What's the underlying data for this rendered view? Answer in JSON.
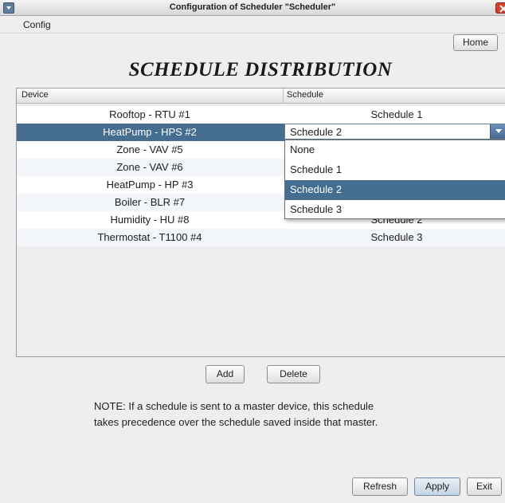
{
  "window": {
    "title": "Configuration of Scheduler \"Scheduler\""
  },
  "menubar": {
    "config_label": "Config",
    "home_label": "Home"
  },
  "heading": "SCHEDULE DISTRIBUTION",
  "table": {
    "columns": [
      "Device",
      "Schedule"
    ],
    "rows": [
      {
        "device": "Rooftop - RTU #1",
        "schedule": "Schedule 1"
      },
      {
        "device": "HeatPump - HPS #2",
        "schedule": "Schedule 2"
      },
      {
        "device": "Zone - VAV #5",
        "schedule": ""
      },
      {
        "device": "Zone - VAV #6",
        "schedule": ""
      },
      {
        "device": "HeatPump - HP #3",
        "schedule": ""
      },
      {
        "device": "Boiler - BLR #7",
        "schedule": ""
      },
      {
        "device": "Humidity - HU #8",
        "schedule": "Schedule 2"
      },
      {
        "device": "Thermostat - T1100 #4",
        "schedule": "Schedule 3"
      }
    ],
    "selected_row": 1
  },
  "schedule_combo": {
    "value": "Schedule 2",
    "options": [
      "None",
      "Schedule 1",
      "Schedule 2",
      "Schedule 3"
    ],
    "highlighted_index": 2
  },
  "actions": {
    "add_label": "Add",
    "delete_label": "Delete"
  },
  "note": {
    "line1": "NOTE: If a schedule is sent to a master device, this schedule",
    "line2": "takes precedence over the schedule saved inside that master."
  },
  "footer": {
    "refresh_label": "Refresh",
    "apply_label": "Apply",
    "exit_label": "Exit"
  },
  "colors": {
    "selection": "#446d8f",
    "row_alt": "#f2f5f9",
    "close_button": "#d7402f"
  },
  "icons": {
    "system_menu": "down-triangle-icon",
    "close": "close-icon",
    "combo_arrow": "chevron-down-icon"
  }
}
